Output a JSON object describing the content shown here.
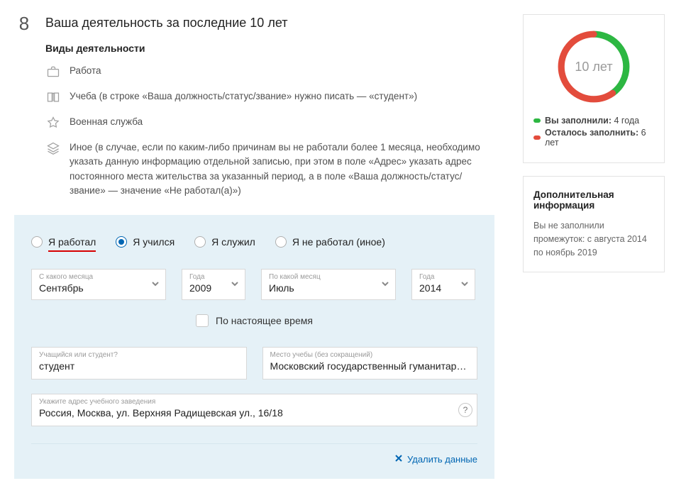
{
  "step": {
    "number": "8",
    "title": "Ваша деятельность за последние 10 лет"
  },
  "categories": {
    "subtitle": "Виды деятельности",
    "work": "Работа",
    "study": "Учеба (в строке «Ваша должность/статус/звание» нужно писать — «студент»)",
    "army": "Военная служба",
    "other": "Иное (в случае, если по каким-либо причинам вы не работали более 1 месяца, необходимо указать данную информацию отдельной записью, при этом в поле «Адрес» указать адрес постоянного места жительства за указанный период, а в поле «Ваша должность/статус/звание» — значение «Не работал(а)»)"
  },
  "radios": {
    "worked": "Я работал",
    "studied": "Я учился",
    "served": "Я служил",
    "idle": "Я не работал (иное)",
    "selected": "studied"
  },
  "period": {
    "from_month_label": "С какого месяца",
    "from_month_value": "Сентябрь",
    "from_year_label": "Года",
    "from_year_value": "2009",
    "to_month_label": "По какой месяц",
    "to_month_value": "Июль",
    "to_year_label": "Года",
    "to_year_value": "2014"
  },
  "present": {
    "label": "По настоящее время"
  },
  "status": {
    "label": "Учащийся или студент?",
    "value": "студент"
  },
  "place": {
    "label": "Место учебы (без сокращений)",
    "value": "Московский государственный гуманитарный"
  },
  "address": {
    "label": "Укажите адрес учебного заведения",
    "value": "Россия, Москва, ул. Верхняя Радищевская ул., 16/18"
  },
  "delete_label": "Удалить данные",
  "donut": {
    "center": "10 лет",
    "done_label": "Вы заполнили:",
    "done_value": "4 года",
    "remain_label": "Осталось заполнить:",
    "remain_value": "6 лет"
  },
  "info_card": {
    "title": "Дополнительная информация",
    "text": "Вы не заполнили промежуток: с августа 2014 по ноябрь 2019"
  },
  "help_char": "?"
}
